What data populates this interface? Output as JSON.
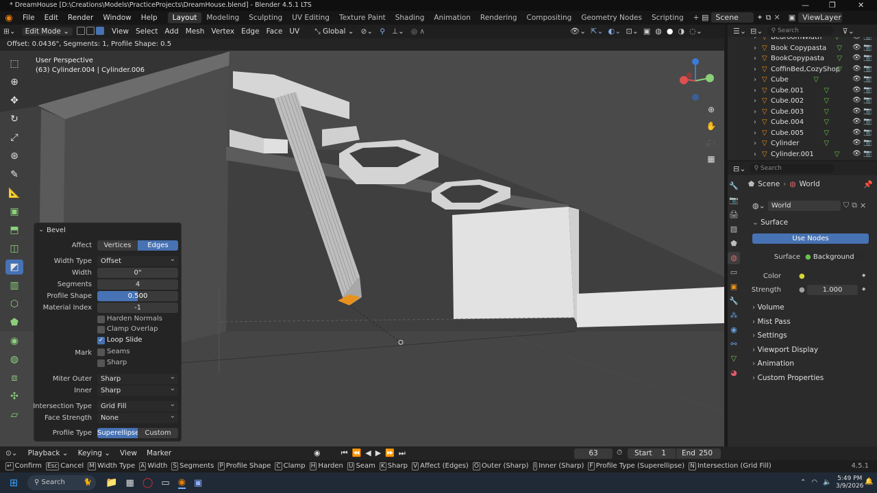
{
  "window": {
    "title": "* DreamHouse [D:\\Creations\\Models\\PracticeProjects\\DreamHouse.blend] - Blender 4.5.1 LTS",
    "minimize": "—",
    "maximize": "❐",
    "close": "✕"
  },
  "menu": {
    "items": [
      "File",
      "Edit",
      "Render",
      "Window",
      "Help"
    ],
    "workspaces": [
      "Layout",
      "Modeling",
      "Sculpting",
      "UV Editing",
      "Texture Paint",
      "Shading",
      "Animation",
      "Rendering",
      "Compositing",
      "Geometry Nodes",
      "Scripting"
    ],
    "add_workspace": "+",
    "scene_label": "Scene",
    "viewlayer_label": "ViewLayer"
  },
  "viewport_header": {
    "mode": "Edit Mode",
    "menus": [
      "View",
      "Select",
      "Add",
      "Mesh",
      "Vertex",
      "Edge",
      "Face",
      "UV"
    ],
    "orientation": "Global"
  },
  "operator_info": "Offset: 0.0436\", Segments: 1, Profile Shape: 0.5",
  "viewport": {
    "view_name": "User Perspective",
    "object_info": "(63) Cylinder.004 | Cylinder.006"
  },
  "bevel": {
    "title": "Bevel",
    "affect_label": "Affect",
    "affect_options": [
      "Vertices",
      "Edges"
    ],
    "width_type_label": "Width Type",
    "width_type": "Offset",
    "width_label": "Width",
    "width": "0\"",
    "segments_label": "Segments",
    "segments": "4",
    "profile_shape_label": "Profile Shape",
    "profile_shape": "0.500",
    "profile_shape_fraction": 0.5,
    "material_index_label": "Material Index",
    "material_index": "-1",
    "harden_normals": "Harden Normals",
    "clamp_overlap": "Clamp Overlap",
    "loop_slide": "Loop Slide",
    "mark_label": "Mark",
    "seams": "Seams",
    "sharp": "Sharp",
    "miter_outer_label": "Miter Outer",
    "miter_outer": "Sharp",
    "inner_label": "Inner",
    "inner": "Sharp",
    "intersection_label": "Intersection Type",
    "intersection": "Grid Fill",
    "face_strength_label": "Face Strength",
    "face_strength": "None",
    "profile_type_label": "Profile Type",
    "profile_type_options": [
      "Superellipse",
      "Custom"
    ]
  },
  "outliner": {
    "search_placeholder": "Search",
    "items": [
      "BedroomWidth",
      "Book Copypasta",
      "BookCopypasta",
      "CoffinBed,CozyShopDes",
      "Cube",
      "Cube.001",
      "Cube.002",
      "Cube.003",
      "Cube.004",
      "Cube.005",
      "Cylinder",
      "Cylinder.001"
    ]
  },
  "properties": {
    "search_placeholder": "Search",
    "breadcrumb_scene": "Scene",
    "breadcrumb_world": "World",
    "world_name": "World",
    "surface_section": "Surface",
    "use_nodes": "Use Nodes",
    "surface_label": "Surface",
    "surface_value": "Background",
    "color_label": "Color",
    "strength_label": "Strength",
    "strength_value": "1.000",
    "sections": [
      "Volume",
      "Mist Pass",
      "Settings",
      "Viewport Display",
      "Animation",
      "Custom Properties"
    ]
  },
  "timeline": {
    "menus": [
      "Playback",
      "Keying",
      "View",
      "Marker"
    ],
    "current_frame": "63",
    "start_label": "Start",
    "start": "1",
    "end_label": "End",
    "end": "250"
  },
  "statusbar": {
    "items": [
      {
        "key": "↵",
        "label": "Confirm"
      },
      {
        "key": "Esc",
        "label": "Cancel"
      },
      {
        "key": "M",
        "label": "Width Type"
      },
      {
        "key": "A",
        "label": "Width"
      },
      {
        "key": "S",
        "label": "Segments"
      },
      {
        "key": "P",
        "label": "Profile Shape"
      },
      {
        "key": "C",
        "label": "Clamp"
      },
      {
        "key": "H",
        "label": "Harden"
      },
      {
        "key": "U",
        "label": "Seam"
      },
      {
        "key": "K",
        "label": "Sharp"
      },
      {
        "key": "V",
        "label": "Affect (Edges)"
      },
      {
        "key": "O",
        "label": "Outer (Sharp)"
      },
      {
        "key": "I",
        "label": "Inner (Sharp)"
      },
      {
        "key": "F",
        "label": "Profile Type (Superellipse)"
      },
      {
        "key": "N",
        "label": "Intersection (Grid Fill)"
      }
    ],
    "version": "4.5.1"
  },
  "taskbar": {
    "search_placeholder": "Search",
    "time": "5:49 PM",
    "date": "3/9/2026"
  },
  "colors": {
    "accent": "#4772b3",
    "selected_edge": "#e8921e",
    "object_icon": "#e8921e",
    "mesh_icon": "#6ac14a"
  }
}
